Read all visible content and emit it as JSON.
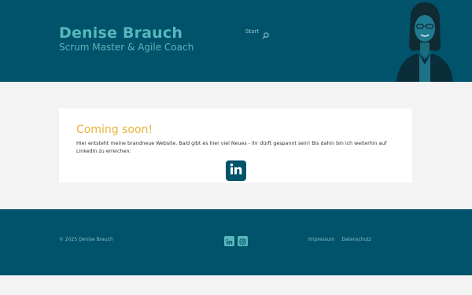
{
  "header": {
    "title": "Denise Brauch",
    "subtitle": "Scrum Master & Agile Coach",
    "nav": [
      {
        "label": "Start"
      }
    ],
    "search_icon": "search-icon",
    "portrait_icon": "portrait-photo"
  },
  "main": {
    "heading": "Coming soon!",
    "text": "Hier entsteht meine brandneue Website. Bald gibt es hier viel Neues - ihr dürft gespannt sein! Bis dahin bin ich weiterhin auf LinkedIn zu erreichen:",
    "linkedin_icon": "linkedin-icon"
  },
  "footer": {
    "copyright": "© 2025 Denise Brauch",
    "social_icons": [
      "linkedin-icon",
      "instagram-icon"
    ],
    "links": [
      {
        "label": "Impressum"
      },
      {
        "label": "Datenschutz"
      }
    ]
  },
  "colors": {
    "brand_dark": "#00536b",
    "brand_teal": "#57b7bd",
    "accent_yellow": "#e7b33a",
    "background": "#f3f3f3"
  }
}
